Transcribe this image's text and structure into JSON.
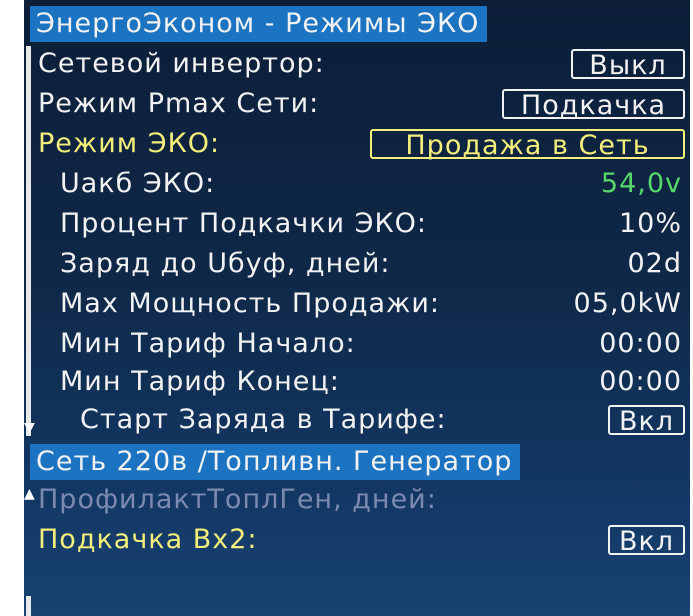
{
  "section1": {
    "header": "ЭнергоЭконом - Режимы ЭКО",
    "rows": [
      {
        "label": "Сетевой инвертор:",
        "value": "Выкл"
      },
      {
        "label": "Режим Pmax Сети:",
        "value": "Подкачка"
      },
      {
        "label": "Режим ЭКО:",
        "value": "Продажа в Сеть"
      },
      {
        "label": "Uакб ЭКО:",
        "value": "54,0v"
      },
      {
        "label": "Процент Подкачки ЭКО:",
        "value": "10%"
      },
      {
        "label": "Заряд до Uбуф, дней:",
        "value": "02d"
      },
      {
        "label": "Max Мощность Продажи:",
        "value": "05,0kW"
      },
      {
        "label": "Мин Тариф Начало:",
        "value": "00:00"
      },
      {
        "label": "Мин Тариф Конец:",
        "value": "00:00"
      },
      {
        "label": "Старт Заряда в Тарифе:",
        "value": "Вкл"
      }
    ]
  },
  "section2": {
    "header": "Сеть 220в /Топливн. Генератор",
    "rows": [
      {
        "label": "ПрофилактТоплГен, дней:"
      },
      {
        "label": "Подкачка Bx2:",
        "value": "Вкл"
      }
    ]
  },
  "colors": {
    "background": "#0f2848",
    "header_bg": "#1b73c2",
    "text": "#f2f2f2",
    "selected": "#f4ee7a",
    "value_highlight": "#56d86a",
    "disabled": "#7d8ab0"
  },
  "icons": [
    "scroll-down-arrow-icon",
    "scroll-up-arrow-icon"
  ]
}
